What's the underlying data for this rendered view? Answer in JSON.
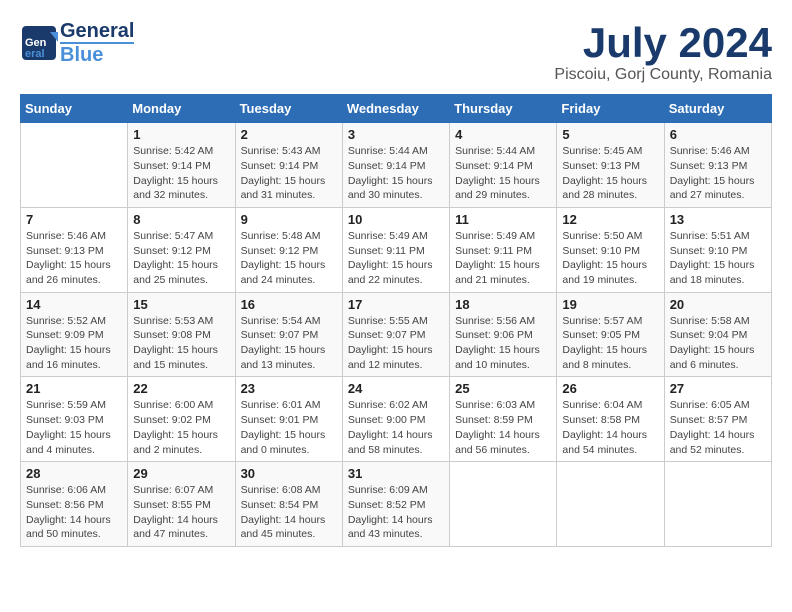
{
  "header": {
    "logo_general": "General",
    "logo_blue": "Blue",
    "month_title": "July 2024",
    "subtitle": "Piscoiu, Gorj County, Romania"
  },
  "days_of_week": [
    "Sunday",
    "Monday",
    "Tuesday",
    "Wednesday",
    "Thursday",
    "Friday",
    "Saturday"
  ],
  "weeks": [
    [
      {
        "num": "",
        "sunrise": "",
        "sunset": "",
        "daylight": ""
      },
      {
        "num": "1",
        "sunrise": "Sunrise: 5:42 AM",
        "sunset": "Sunset: 9:14 PM",
        "daylight": "Daylight: 15 hours and 32 minutes."
      },
      {
        "num": "2",
        "sunrise": "Sunrise: 5:43 AM",
        "sunset": "Sunset: 9:14 PM",
        "daylight": "Daylight: 15 hours and 31 minutes."
      },
      {
        "num": "3",
        "sunrise": "Sunrise: 5:44 AM",
        "sunset": "Sunset: 9:14 PM",
        "daylight": "Daylight: 15 hours and 30 minutes."
      },
      {
        "num": "4",
        "sunrise": "Sunrise: 5:44 AM",
        "sunset": "Sunset: 9:14 PM",
        "daylight": "Daylight: 15 hours and 29 minutes."
      },
      {
        "num": "5",
        "sunrise": "Sunrise: 5:45 AM",
        "sunset": "Sunset: 9:13 PM",
        "daylight": "Daylight: 15 hours and 28 minutes."
      },
      {
        "num": "6",
        "sunrise": "Sunrise: 5:46 AM",
        "sunset": "Sunset: 9:13 PM",
        "daylight": "Daylight: 15 hours and 27 minutes."
      }
    ],
    [
      {
        "num": "7",
        "sunrise": "Sunrise: 5:46 AM",
        "sunset": "Sunset: 9:13 PM",
        "daylight": "Daylight: 15 hours and 26 minutes."
      },
      {
        "num": "8",
        "sunrise": "Sunrise: 5:47 AM",
        "sunset": "Sunset: 9:12 PM",
        "daylight": "Daylight: 15 hours and 25 minutes."
      },
      {
        "num": "9",
        "sunrise": "Sunrise: 5:48 AM",
        "sunset": "Sunset: 9:12 PM",
        "daylight": "Daylight: 15 hours and 24 minutes."
      },
      {
        "num": "10",
        "sunrise": "Sunrise: 5:49 AM",
        "sunset": "Sunset: 9:11 PM",
        "daylight": "Daylight: 15 hours and 22 minutes."
      },
      {
        "num": "11",
        "sunrise": "Sunrise: 5:49 AM",
        "sunset": "Sunset: 9:11 PM",
        "daylight": "Daylight: 15 hours and 21 minutes."
      },
      {
        "num": "12",
        "sunrise": "Sunrise: 5:50 AM",
        "sunset": "Sunset: 9:10 PM",
        "daylight": "Daylight: 15 hours and 19 minutes."
      },
      {
        "num": "13",
        "sunrise": "Sunrise: 5:51 AM",
        "sunset": "Sunset: 9:10 PM",
        "daylight": "Daylight: 15 hours and 18 minutes."
      }
    ],
    [
      {
        "num": "14",
        "sunrise": "Sunrise: 5:52 AM",
        "sunset": "Sunset: 9:09 PM",
        "daylight": "Daylight: 15 hours and 16 minutes."
      },
      {
        "num": "15",
        "sunrise": "Sunrise: 5:53 AM",
        "sunset": "Sunset: 9:08 PM",
        "daylight": "Daylight: 15 hours and 15 minutes."
      },
      {
        "num": "16",
        "sunrise": "Sunrise: 5:54 AM",
        "sunset": "Sunset: 9:07 PM",
        "daylight": "Daylight: 15 hours and 13 minutes."
      },
      {
        "num": "17",
        "sunrise": "Sunrise: 5:55 AM",
        "sunset": "Sunset: 9:07 PM",
        "daylight": "Daylight: 15 hours and 12 minutes."
      },
      {
        "num": "18",
        "sunrise": "Sunrise: 5:56 AM",
        "sunset": "Sunset: 9:06 PM",
        "daylight": "Daylight: 15 hours and 10 minutes."
      },
      {
        "num": "19",
        "sunrise": "Sunrise: 5:57 AM",
        "sunset": "Sunset: 9:05 PM",
        "daylight": "Daylight: 15 hours and 8 minutes."
      },
      {
        "num": "20",
        "sunrise": "Sunrise: 5:58 AM",
        "sunset": "Sunset: 9:04 PM",
        "daylight": "Daylight: 15 hours and 6 minutes."
      }
    ],
    [
      {
        "num": "21",
        "sunrise": "Sunrise: 5:59 AM",
        "sunset": "Sunset: 9:03 PM",
        "daylight": "Daylight: 15 hours and 4 minutes."
      },
      {
        "num": "22",
        "sunrise": "Sunrise: 6:00 AM",
        "sunset": "Sunset: 9:02 PM",
        "daylight": "Daylight: 15 hours and 2 minutes."
      },
      {
        "num": "23",
        "sunrise": "Sunrise: 6:01 AM",
        "sunset": "Sunset: 9:01 PM",
        "daylight": "Daylight: 15 hours and 0 minutes."
      },
      {
        "num": "24",
        "sunrise": "Sunrise: 6:02 AM",
        "sunset": "Sunset: 9:00 PM",
        "daylight": "Daylight: 14 hours and 58 minutes."
      },
      {
        "num": "25",
        "sunrise": "Sunrise: 6:03 AM",
        "sunset": "Sunset: 8:59 PM",
        "daylight": "Daylight: 14 hours and 56 minutes."
      },
      {
        "num": "26",
        "sunrise": "Sunrise: 6:04 AM",
        "sunset": "Sunset: 8:58 PM",
        "daylight": "Daylight: 14 hours and 54 minutes."
      },
      {
        "num": "27",
        "sunrise": "Sunrise: 6:05 AM",
        "sunset": "Sunset: 8:57 PM",
        "daylight": "Daylight: 14 hours and 52 minutes."
      }
    ],
    [
      {
        "num": "28",
        "sunrise": "Sunrise: 6:06 AM",
        "sunset": "Sunset: 8:56 PM",
        "daylight": "Daylight: 14 hours and 50 minutes."
      },
      {
        "num": "29",
        "sunrise": "Sunrise: 6:07 AM",
        "sunset": "Sunset: 8:55 PM",
        "daylight": "Daylight: 14 hours and 47 minutes."
      },
      {
        "num": "30",
        "sunrise": "Sunrise: 6:08 AM",
        "sunset": "Sunset: 8:54 PM",
        "daylight": "Daylight: 14 hours and 45 minutes."
      },
      {
        "num": "31",
        "sunrise": "Sunrise: 6:09 AM",
        "sunset": "Sunset: 8:52 PM",
        "daylight": "Daylight: 14 hours and 43 minutes."
      },
      {
        "num": "",
        "sunrise": "",
        "sunset": "",
        "daylight": ""
      },
      {
        "num": "",
        "sunrise": "",
        "sunset": "",
        "daylight": ""
      },
      {
        "num": "",
        "sunrise": "",
        "sunset": "",
        "daylight": ""
      }
    ]
  ]
}
